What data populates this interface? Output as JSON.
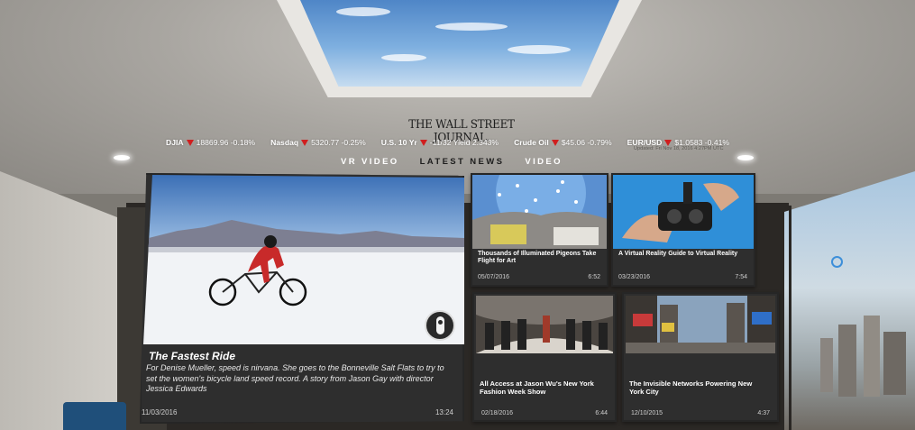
{
  "header": {
    "logo": "THE WALL STREET JOURNAL.",
    "updated": "Updated: Fri Nov 18, 2016 4:27PM UTC"
  },
  "ticker": [
    {
      "name": "DJIA",
      "value": "18869.96 -0.18%",
      "direction": "down"
    },
    {
      "name": "Nasdaq",
      "value": "5320.77 -0.25%",
      "direction": "down"
    },
    {
      "name": "U.S. 10 Yr",
      "value": "-11/32 Yield 2.343%",
      "direction": "down"
    },
    {
      "name": "Crude Oil",
      "value": "$45.06 -0.79%",
      "direction": "down"
    },
    {
      "name": "EUR/USD",
      "value": "$1.0583 -0.41%",
      "direction": "down"
    }
  ],
  "tabs": [
    {
      "label": "VR VIDEO",
      "active": false
    },
    {
      "label": "LATEST NEWS",
      "active": true
    },
    {
      "label": "VIDEO",
      "active": false
    }
  ],
  "featured": {
    "title": "The Fastest Ride",
    "description": "For Denise Mueller, speed is nirvana. She goes to the Bonneville Salt Flats to try to set the women's bicycle land speed record. A story from Jason Gay with director Jessica Edwards",
    "date": "11/03/2016",
    "duration": "13:24",
    "badge_icon": "vr-controller-icon"
  },
  "cards": [
    {
      "title": "Thousands of Illuminated Pigeons Take Flight for Art",
      "date": "05/07/2016",
      "duration": "6:52"
    },
    {
      "title": "A Virtual Reality Guide to Virtual Reality",
      "date": "03/23/2016",
      "duration": "7:54"
    },
    {
      "title": "All Access at Jason Wu's New York Fashion Week Show",
      "date": "02/18/2016",
      "duration": "6:44"
    },
    {
      "title": "The Invisible Networks Powering New York City",
      "date": "12/10/2015",
      "duration": "4:37"
    }
  ],
  "colors": {
    "accent_down": "#d01e1e",
    "card_bg": "#2e2e2e",
    "cursor": "#3d8fd9"
  }
}
